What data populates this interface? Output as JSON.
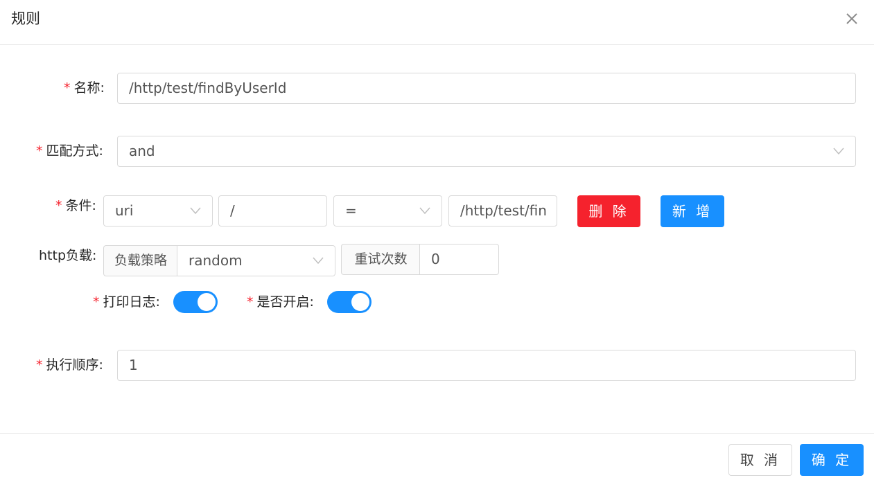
{
  "dialog": {
    "title": "规则",
    "close_icon": "close-icon"
  },
  "form": {
    "required_mark": "*",
    "name": {
      "label": "名称:",
      "value": "/http/test/findByUserId"
    },
    "match_mode": {
      "label": "匹配方式:",
      "value": "and"
    },
    "condition": {
      "label": "条件:",
      "param_type": "uri",
      "param_name": "/",
      "operator": "=",
      "param_value": "/http/test/fin",
      "delete_label": "删 除",
      "add_label": "新 增"
    },
    "http_load": {
      "label": "http负载:",
      "strategy_addon": "负载策略",
      "strategy_value": "random",
      "retry_addon": "重试次数",
      "retry_value": "0"
    },
    "print_log": {
      "label": "打印日志:",
      "enabled": true
    },
    "is_open": {
      "label": "是否开启:",
      "enabled": true
    },
    "order": {
      "label": "执行顺序:",
      "value": "1"
    }
  },
  "footer": {
    "cancel_label": "取 消",
    "confirm_label": "确 定"
  },
  "colors": {
    "primary": "#1890ff",
    "danger": "#f5222d",
    "border": "#d9d9d9",
    "required": "#f5222d"
  }
}
